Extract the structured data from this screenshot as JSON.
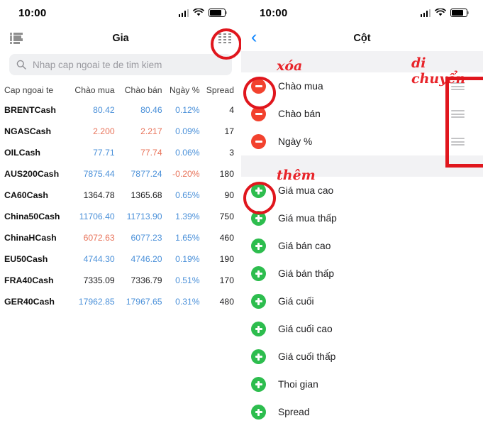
{
  "left": {
    "status": {
      "time": "10:00",
      "signal_icon": "signal-bars-icon",
      "wifi_icon": "wifi-icon",
      "battery_icon": "battery-icon"
    },
    "nav": {
      "menu_icon": "list-lines-icon",
      "title": "Gia",
      "columns_icon": "grid-columns-icon"
    },
    "search": {
      "icon": "search-icon",
      "placeholder": "Nhap cap ngoai te de tim kiem",
      "value": ""
    },
    "table": {
      "headers": [
        "Cap ngoai te",
        "Chào mua",
        "Chào bán",
        "Ngày %",
        "Spread"
      ],
      "rows": [
        {
          "symbol": "BRENTCash",
          "bid": "80.42",
          "bid_dir": "up",
          "ask": "80.46",
          "ask_dir": "up",
          "pct": "0.12%",
          "pct_dir": "up",
          "spread": "4"
        },
        {
          "symbol": "NGASCash",
          "bid": "2.200",
          "bid_dir": "down",
          "ask": "2.217",
          "ask_dir": "down",
          "pct": "0.09%",
          "pct_dir": "up",
          "spread": "17"
        },
        {
          "symbol": "OILCash",
          "bid": "77.71",
          "bid_dir": "up",
          "ask": "77.74",
          "ask_dir": "down",
          "pct": "0.06%",
          "pct_dir": "up",
          "spread": "3"
        },
        {
          "symbol": "AUS200Cash",
          "bid": "7875.44",
          "bid_dir": "up",
          "ask": "7877.24",
          "ask_dir": "up",
          "pct": "-0.20%",
          "pct_dir": "down",
          "spread": "180"
        },
        {
          "symbol": "CA60Cash",
          "bid": "1364.78",
          "bid_dir": "flat",
          "ask": "1365.68",
          "ask_dir": "flat",
          "pct": "0.65%",
          "pct_dir": "up",
          "spread": "90"
        },
        {
          "symbol": "China50Cash",
          "bid": "11706.40",
          "bid_dir": "up",
          "ask": "11713.90",
          "ask_dir": "up",
          "pct": "1.39%",
          "pct_dir": "up",
          "spread": "750"
        },
        {
          "symbol": "ChinaHCash",
          "bid": "6072.63",
          "bid_dir": "down",
          "ask": "6077.23",
          "ask_dir": "up",
          "pct": "1.65%",
          "pct_dir": "up",
          "spread": "460"
        },
        {
          "symbol": "EU50Cash",
          "bid": "4744.30",
          "bid_dir": "up",
          "ask": "4746.20",
          "ask_dir": "up",
          "pct": "0.19%",
          "pct_dir": "up",
          "spread": "190"
        },
        {
          "symbol": "FRA40Cash",
          "bid": "7335.09",
          "bid_dir": "flat",
          "ask": "7336.79",
          "ask_dir": "flat",
          "pct": "0.51%",
          "pct_dir": "up",
          "spread": "170"
        },
        {
          "symbol": "GER40Cash",
          "bid": "17962.85",
          "bid_dir": "up",
          "ask": "17967.65",
          "ask_dir": "up",
          "pct": "0.31%",
          "pct_dir": "up",
          "spread": "480"
        }
      ]
    }
  },
  "right": {
    "status": {
      "time": "10:00",
      "signal_icon": "signal-bars-icon",
      "wifi_icon": "wifi-icon",
      "battery_icon": "battery-icon"
    },
    "nav": {
      "back_icon": "chevron-left-icon",
      "title": "Cột"
    },
    "active_section": {
      "annotation": "xóa",
      "move_annotation": "di chuyển"
    },
    "active_columns": [
      {
        "label": "Chào mua",
        "action_icon": "minus-circle-icon",
        "drag_icon": "drag-handle-icon"
      },
      {
        "label": "Chào bán",
        "action_icon": "minus-circle-icon",
        "drag_icon": "drag-handle-icon"
      },
      {
        "label": "Ngày %",
        "action_icon": "minus-circle-icon",
        "drag_icon": "drag-handle-icon"
      }
    ],
    "add_section": {
      "annotation": "thêm"
    },
    "available_columns": [
      {
        "label": "Giá mua cao",
        "action_icon": "plus-circle-icon"
      },
      {
        "label": "Giá mua thấp",
        "action_icon": "plus-circle-icon"
      },
      {
        "label": "Giá bán cao",
        "action_icon": "plus-circle-icon"
      },
      {
        "label": "Giá bán thấp",
        "action_icon": "plus-circle-icon"
      },
      {
        "label": "Giá cuối",
        "action_icon": "plus-circle-icon"
      },
      {
        "label": "Giá cuối cao",
        "action_icon": "plus-circle-icon"
      },
      {
        "label": "Giá cuối thấp",
        "action_icon": "plus-circle-icon"
      },
      {
        "label": "Thoi gian",
        "action_icon": "plus-circle-icon"
      },
      {
        "label": "Spread",
        "action_icon": "plus-circle-icon"
      }
    ]
  },
  "colors": {
    "up": "#4a90d9",
    "down": "#e8735a",
    "flat": "#1c1c1e",
    "annotation": "#e0161d",
    "remove": "#f2422e",
    "add": "#2dbd4e",
    "accent": "#0a84ff"
  }
}
